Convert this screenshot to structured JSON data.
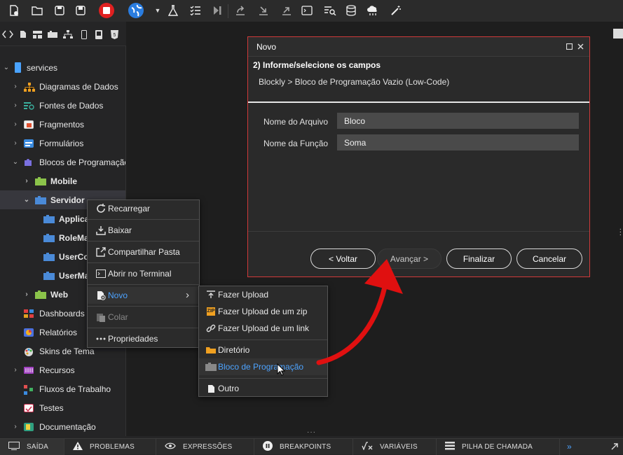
{
  "toolbar": {
    "icons": [
      "new-file-icon",
      "open-folder-icon",
      "save-icon",
      "save-all-icon",
      "stop-icon",
      "globe-icon",
      "dropdown-icon",
      "flask-icon",
      "checklist-icon",
      "step-icon",
      "export-icon",
      "import-icon",
      "upload-icon",
      "terminal-icon",
      "search-list-icon",
      "database-icon",
      "cloud-icon",
      "magic-wand-icon"
    ],
    "stop_color": "#e02020"
  },
  "subtoolbar": {
    "icons": [
      "code-icon",
      "file-icon",
      "layout-icon",
      "component-icon",
      "tree-icon",
      "mobile-icon",
      "device-icon",
      "html5-icon"
    ]
  },
  "sidebar": {
    "items": [
      {
        "label": "services",
        "color": "#4aa3ff"
      },
      {
        "label": "Diagramas de Dados",
        "color": "#f0a020"
      },
      {
        "label": "Fontes de Dados",
        "color": "#3ab09e"
      },
      {
        "label": "Fragmentos",
        "color": "#e05030"
      },
      {
        "label": "Formulários",
        "color": "#3a8be0"
      },
      {
        "label": "Blocos de Programação",
        "color": "#6a6ae0"
      },
      {
        "label": "Mobile",
        "color": "#8bc34a"
      },
      {
        "label": "Servidor",
        "color": "#4a8ad8"
      },
      {
        "label": "Applica",
        "color": "#4a8ad8"
      },
      {
        "label": "RoleMa",
        "color": "#4a8ad8"
      },
      {
        "label": "UserCo",
        "color": "#4a8ad8"
      },
      {
        "label": "UserMa",
        "color": "#4a8ad8"
      },
      {
        "label": "Web",
        "color": "#8bc34a"
      },
      {
        "label": "Dashboards",
        "color": "#e04040"
      },
      {
        "label": "Relatórios",
        "color": "#4a70e0"
      },
      {
        "label": "Skins de Tema",
        "color": "#e0a040"
      },
      {
        "label": "Recursos",
        "color": "#a040c0"
      },
      {
        "label": "Fluxos de Trabalho",
        "color": "#e05050"
      },
      {
        "label": "Testes",
        "color": "#d03050"
      },
      {
        "label": "Documentação",
        "color": "#30a080"
      }
    ]
  },
  "context_menu": {
    "items": [
      {
        "label": "Recarregar",
        "icon": "reload-icon"
      },
      {
        "label": "Baixar",
        "icon": "download-icon"
      },
      {
        "label": "Compartilhar Pasta",
        "icon": "share-icon"
      },
      {
        "label": "Abrir no Terminal",
        "icon": "terminal-icon"
      },
      {
        "label": "Novo",
        "icon": "new-icon"
      },
      {
        "label": "Colar",
        "icon": "paste-icon"
      },
      {
        "label": "Propriedades",
        "icon": "more-icon"
      }
    ],
    "submenu_arrow": "›"
  },
  "submenu": {
    "items": [
      {
        "label": "Fazer Upload",
        "icon": "upload-icon"
      },
      {
        "label": "Fazer Upload de um zip",
        "icon": "zip-icon"
      },
      {
        "label": "Fazer Upload de um link",
        "icon": "link-icon"
      },
      {
        "label": "Diretório",
        "icon": "folder-icon"
      },
      {
        "label": "Bloco de Programação",
        "icon": "block-icon"
      },
      {
        "label": "Outro",
        "icon": "file-icon"
      }
    ],
    "zip_badge": "ZIP"
  },
  "dialog": {
    "title": "Novo",
    "step": "2) Informe/selecione os campos",
    "breadcrumb": "Blockly > Bloco de Programação Vazio (Low-Code)",
    "fields": [
      {
        "label": "Nome do Arquivo",
        "value": "Bloco"
      },
      {
        "label": "Nome da Função",
        "value": "Soma"
      }
    ],
    "buttons": {
      "back": "< Voltar",
      "next": "Avançar >",
      "finish": "Finalizar",
      "cancel": "Cancelar"
    }
  },
  "bottom_tabs": [
    {
      "label": "SAÍDA",
      "icon": "output-icon"
    },
    {
      "label": "PROBLEMAS",
      "icon": "warning-icon"
    },
    {
      "label": "EXPRESSÕES",
      "icon": "eye-icon"
    },
    {
      "label": "BREAKPOINTS",
      "icon": "pause-icon"
    },
    {
      "label": "VARIÁVEIS",
      "icon": "variable-icon"
    },
    {
      "label": "PILHA DE CHAMADA",
      "icon": "stack-icon"
    }
  ],
  "bottom_more": "»",
  "annotation_color": "#e01010"
}
